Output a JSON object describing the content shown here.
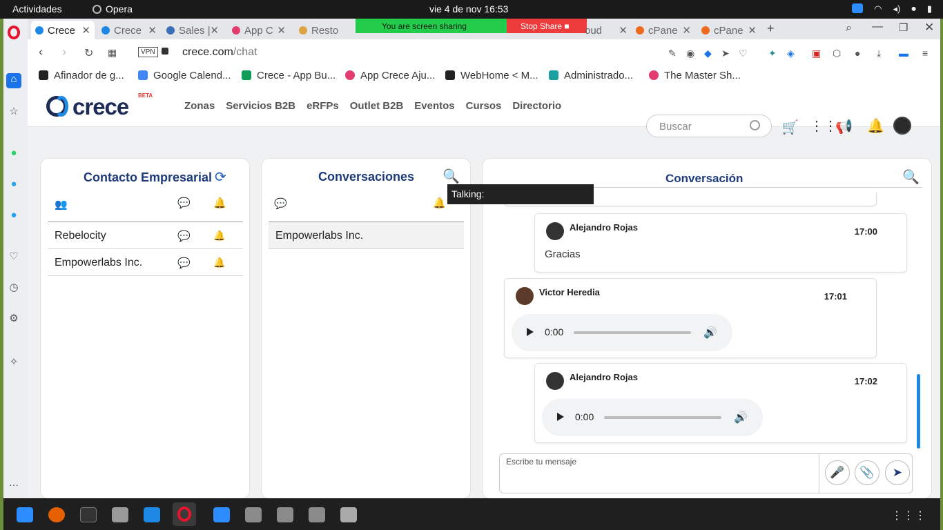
{
  "system": {
    "activities": "Actividades",
    "app_name": "Opera",
    "clock": "vie  4 de nov  16:53"
  },
  "tabs": [
    {
      "label": "Crece",
      "active": true
    },
    {
      "label": "Crece"
    },
    {
      "label": "Sales |"
    },
    {
      "label": "App C"
    },
    {
      "label": "Resto"
    },
    {
      "label": "oud"
    },
    {
      "label": "cPane"
    },
    {
      "label": "cPane"
    }
  ],
  "screen_share": {
    "status": "You are screen sharing",
    "stop_label": "Stop Share"
  },
  "address": {
    "vpn": "VPN",
    "host": "crece.com",
    "path": "/chat"
  },
  "bookmarks": [
    {
      "label": "Afinador de g..."
    },
    {
      "label": "Google Calend..."
    },
    {
      "label": "Crece - App Bu..."
    },
    {
      "label": "App Crece Aju..."
    },
    {
      "label": "WebHome < M..."
    },
    {
      "label": "Administrado..."
    },
    {
      "label": "The Master Sh..."
    }
  ],
  "site": {
    "logo": "crece",
    "beta": "BETA",
    "menu": [
      "Zonas",
      "Servicios B2B",
      "eRFPs",
      "Outlet B2B",
      "Eventos",
      "Cursos",
      "Directorio"
    ],
    "search_placeholder": "Buscar"
  },
  "contacts": {
    "title": "Contacto Empresarial",
    "rows": [
      {
        "name": "Rebelocity"
      },
      {
        "name": "Empowerlabs Inc."
      }
    ]
  },
  "conversations": {
    "title": "Conversaciones",
    "rows": [
      {
        "name": "Empowerlabs Inc."
      }
    ]
  },
  "tooltip": "Talking:",
  "conversation": {
    "title": "Conversación",
    "messages": [
      {
        "author": "Alejandro Rojas",
        "time": "17:00",
        "text": "Gracias"
      },
      {
        "author": "Victor Heredia",
        "time": "17:01",
        "audio_time": "0:00"
      },
      {
        "author": "Alejandro Rojas",
        "time": "17:02",
        "audio_time": "0:00"
      }
    ],
    "compose_placeholder": "Escribe tu mensaje"
  }
}
